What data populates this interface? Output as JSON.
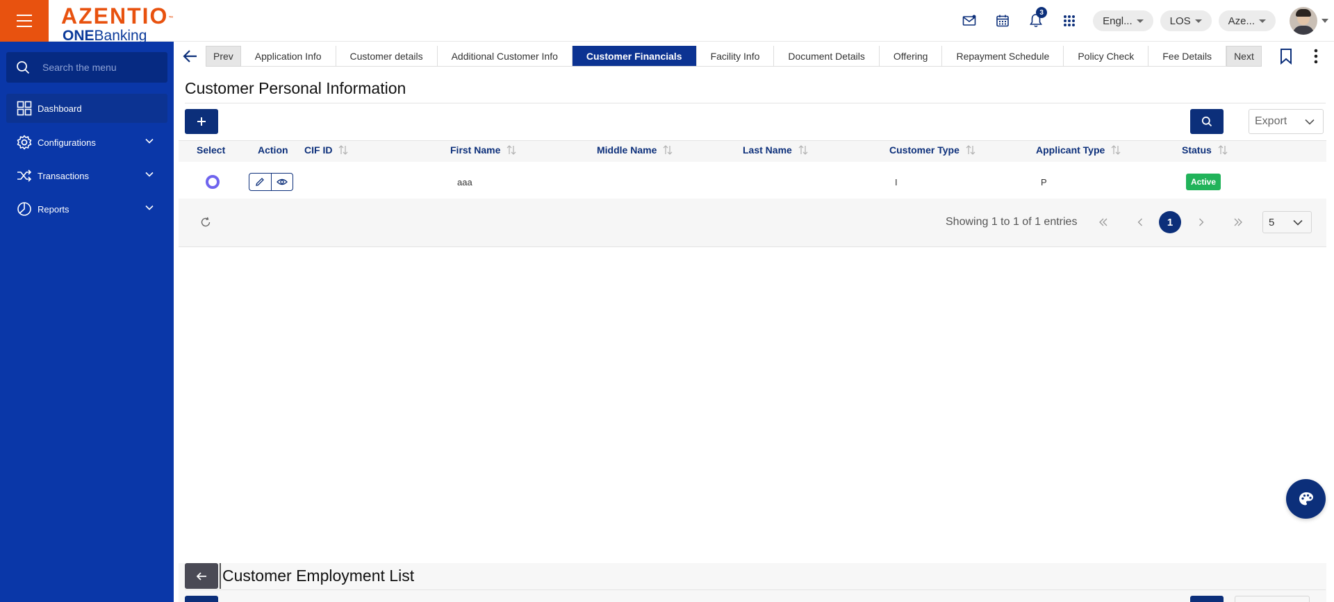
{
  "header": {
    "logo_main": "AZENTIO",
    "logo_tm": "™",
    "logo_sub_bold": "ONE",
    "logo_sub_rest": "Banking",
    "notification_count": "3",
    "language": "Engl...",
    "module": "LOS",
    "entity": "Aze...",
    "icons": [
      "mail-icon",
      "calendar-icon",
      "bell-icon",
      "apps-grid-icon"
    ]
  },
  "sidebar": {
    "search_placeholder": "Search the menu",
    "items": [
      {
        "label": "Dashboard",
        "icon": "dashboard-icon",
        "active": true
      },
      {
        "label": "Configurations",
        "icon": "gear-icon"
      },
      {
        "label": "Transactions",
        "icon": "shuffle-icon"
      },
      {
        "label": "Reports",
        "icon": "pie-chart-icon"
      }
    ]
  },
  "tabs": {
    "prev": "Prev",
    "next": "Next",
    "items": [
      {
        "label": "Application Info"
      },
      {
        "label": "Customer details"
      },
      {
        "label": "Additional Customer Info"
      },
      {
        "label": "Customer Financials",
        "active": true
      },
      {
        "label": "Facility Info"
      },
      {
        "label": "Document Details"
      },
      {
        "label": "Offering"
      },
      {
        "label": "Repayment Schedule"
      },
      {
        "label": "Policy Check"
      },
      {
        "label": "Fee Details"
      }
    ]
  },
  "section": {
    "title": "Customer Personal Information",
    "export_placeholder": "Export"
  },
  "table": {
    "columns": [
      "Select",
      "Action",
      "CIF ID",
      "First Name",
      "Middle Name",
      "Last Name",
      "Customer Type",
      "Applicant Type",
      "Status"
    ],
    "rows": [
      {
        "cif_id": "",
        "first_name": "aaa",
        "middle_name": "",
        "last_name": "",
        "customer_type": "I",
        "applicant_type": "P",
        "status": "Active"
      }
    ]
  },
  "pagination": {
    "info": "Showing 1 to 1 of 1 entries",
    "current_page": "1",
    "page_size": "5"
  },
  "employment": {
    "title": "Customer Employment List"
  },
  "colors": {
    "brand_orange": "#e8520f",
    "sidebar_blue": "#0a37a8",
    "primary_navy": "#0c2f7a",
    "status_green": "#21b35a"
  }
}
